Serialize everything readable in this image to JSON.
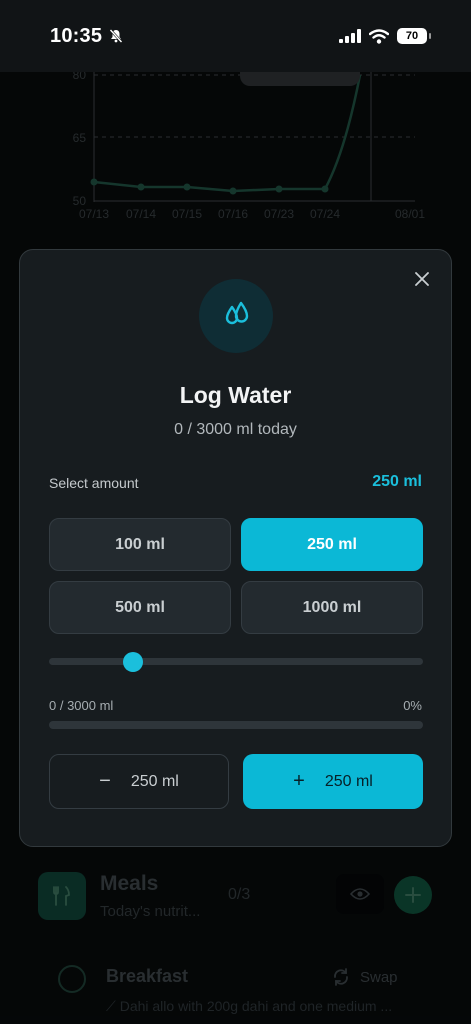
{
  "status_bar": {
    "time": "10:35",
    "battery": "70"
  },
  "background": {
    "chart_y_ticks": [
      "80",
      "65",
      "50"
    ],
    "chart_x_ticks": [
      "07/13",
      "07/14",
      "07/15",
      "07/16",
      "07/23",
      "07/24",
      "08/01"
    ],
    "meals": {
      "title": "Meals",
      "subtitle": "Today's nutrit...",
      "count": "0/3"
    },
    "breakfast": {
      "title": "Breakfast",
      "swap_label": "Swap",
      "description": "Dahi allo with 200g dahi and one medium ..."
    }
  },
  "modal": {
    "title": "Log Water",
    "subtitle": "0 / 3000 ml today",
    "select_label": "Select amount",
    "selected_value": "250 ml",
    "amounts": [
      {
        "label": "100 ml",
        "active": false
      },
      {
        "label": "250 ml",
        "active": true
      },
      {
        "label": "500 ml",
        "active": false
      },
      {
        "label": "1000 ml",
        "active": false
      }
    ],
    "slider_fraction": 0.225,
    "progress": {
      "left_label": "0 / 3000 ml",
      "right_label": "0%",
      "fraction": 0
    },
    "minus_button": {
      "sign": "−",
      "label": "250 ml"
    },
    "plus_button": {
      "sign": "+",
      "label": "250 ml"
    }
  },
  "colors": {
    "accent": "#0bb8d6",
    "modal_bg": "#171c1f",
    "chart_line": "#1e4b3e"
  }
}
